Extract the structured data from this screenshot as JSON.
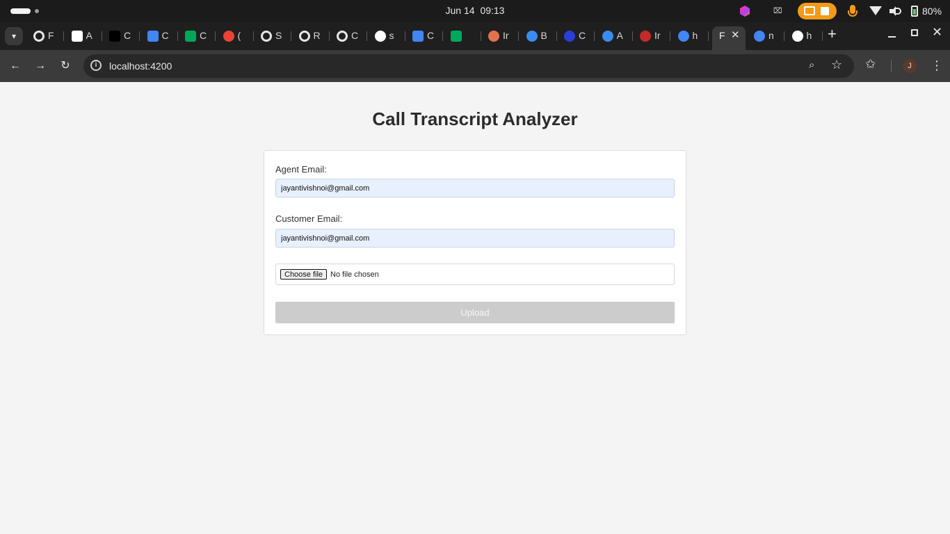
{
  "os": {
    "date": "Jun 14",
    "time": "09:13",
    "battery": "80%",
    "tray_x": "⌧"
  },
  "browser": {
    "tabs": [
      {
        "title": "F",
        "icon": "ring-icon",
        "color": "#e6e6e6"
      },
      {
        "title": "A",
        "icon": "pause-app-icon",
        "color": "#ffffff"
      },
      {
        "title": "C",
        "icon": "m-logo-icon",
        "color": "#000000"
      },
      {
        "title": "C",
        "icon": "calendar-icon",
        "color": "#4285f4"
      },
      {
        "title": "C",
        "icon": "meet-icon",
        "color": "#00a85a"
      },
      {
        "title": "(",
        "icon": "gmail-icon",
        "color": "#ea4335"
      },
      {
        "title": "S",
        "icon": "ring-icon",
        "color": "#e6e6e6"
      },
      {
        "title": "R",
        "icon": "ring-icon",
        "color": "#e6e6e6"
      },
      {
        "title": "C",
        "icon": "ring-icon",
        "color": "#e6e6e6"
      },
      {
        "title": "s",
        "icon": "github-icon",
        "color": "#ffffff"
      },
      {
        "title": "C",
        "icon": "calendar-icon",
        "color": "#4285f4"
      },
      {
        "title": "",
        "icon": "meet-record-icon",
        "color": "#00a85a"
      },
      {
        "title": "Ir",
        "icon": "sunburst-icon",
        "color": "#e2714e"
      },
      {
        "title": "B",
        "icon": "gear-blue-icon",
        "color": "#3b8cf0"
      },
      {
        "title": "C",
        "icon": "gear-darkblue-icon",
        "color": "#2a3fd6"
      },
      {
        "title": "A",
        "icon": "gear-blue-icon",
        "color": "#3b8cf0"
      },
      {
        "title": "Ir",
        "icon": "gauge-icon",
        "color": "#c42a2a"
      },
      {
        "title": "h",
        "icon": "google-icon",
        "color": "#4285f4"
      }
    ],
    "active_tab": {
      "title": "F",
      "close": "✕"
    },
    "tabs_after": [
      {
        "title": "n",
        "icon": "google-icon",
        "color": "#4285f4"
      },
      {
        "title": "h",
        "icon": "github-icon",
        "color": "#ffffff"
      }
    ],
    "new_tab": "+",
    "url": "localhost:4200",
    "avatar_letter": "J"
  },
  "page": {
    "title": "Call Transcript Analyzer",
    "agent_email_label": "Agent Email:",
    "agent_email_value": "jayantivishnoi@gmail.com",
    "customer_email_label": "Customer Email:",
    "customer_email_value": "jayantivishnoi@gmail.com",
    "file_button": "Choose file",
    "file_status": "No file chosen",
    "upload_label": "Upload"
  }
}
